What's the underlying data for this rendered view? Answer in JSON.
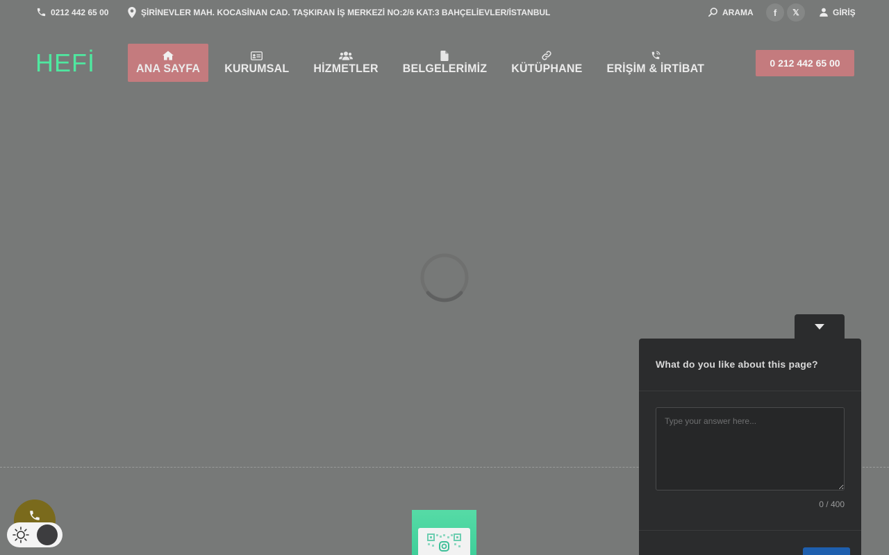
{
  "topbar": {
    "phone": "0212 442 65 00",
    "address": "ŞİRİNEVLER MAH. KOCASİNAN CAD. TAŞKIRAN İŞ MERKEZİ NO:2/6 KAT:3 BAHÇELİEVLER/İSTANBUL",
    "search_label": "ARAMA",
    "social": [
      {
        "name": "facebook",
        "glyph": "f"
      },
      {
        "name": "x",
        "glyph": "𝕏"
      }
    ],
    "login_label": "GİRİŞ"
  },
  "header": {
    "logo": "HEFİ",
    "nav": [
      {
        "label": "ANA SAYFA",
        "icon": "home-icon",
        "active": true
      },
      {
        "label": "KURUMSAL",
        "icon": "id-card-icon",
        "active": false
      },
      {
        "label": "HİZMETLER",
        "icon": "users-icon",
        "active": false
      },
      {
        "label": "BELGELERİMİZ",
        "icon": "document-icon",
        "active": false
      },
      {
        "label": "KÜTÜPHANE",
        "icon": "link-icon",
        "active": false
      },
      {
        "label": "ERİŞİM & İRTİBAT",
        "icon": "phone-volume-icon",
        "active": false
      }
    ],
    "cta_label": "0 212 442 65 00"
  },
  "survey": {
    "question": "What do you like about this page?",
    "placeholder": "Type your answer here...",
    "char_count": "0 / 400"
  },
  "colors": {
    "accent": "#c47b7e",
    "logo": "#4fe8a0",
    "survey_bg": "#2b2c2d",
    "submit": "#1e5fae"
  }
}
